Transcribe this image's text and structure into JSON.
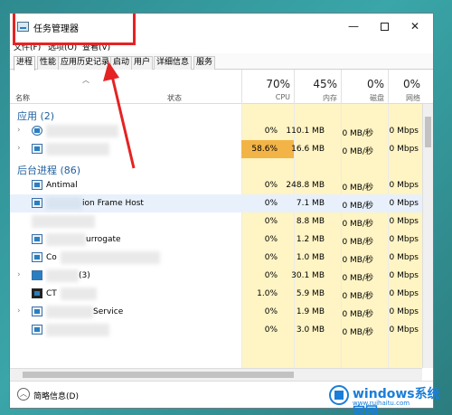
{
  "window": {
    "title": "任务管理器"
  },
  "menu": [
    "文件(F)",
    "选项(O)",
    "查看(V)"
  ],
  "tabs": [
    "进程",
    "性能",
    "应用历史记录",
    "启动",
    "用户",
    "详细信息",
    "服务"
  ],
  "header": {
    "name_label": "名称",
    "status_label": "状态",
    "cpu": {
      "pct": "70%",
      "label": "CPU"
    },
    "mem": {
      "pct": "45%",
      "label": "内存"
    },
    "disk": {
      "pct": "0%",
      "label": "磁盘"
    },
    "net": {
      "pct": "0%",
      "label": "网络"
    }
  },
  "groups": {
    "apps": "应用 (2)",
    "background": "后台进程 (86)"
  },
  "rows": [
    {
      "expand": "›",
      "name": "",
      "cpu": "0%",
      "mem": "110.1 MB",
      "disk": "0 MB/秒",
      "net": "0 Mbps"
    },
    {
      "expand": "›",
      "name": "",
      "cpu": "58.6%",
      "mem": "16.6 MB",
      "disk": "0 MB/秒",
      "net": "0 Mbps"
    },
    {
      "expand": "",
      "name": "Antimal",
      "cpu": "0%",
      "mem": "248.8 MB",
      "disk": "0 MB/秒",
      "net": "0 Mbps"
    },
    {
      "expand": "",
      "name": "ion Frame Host",
      "cpu": "0%",
      "mem": "7.1 MB",
      "disk": "0 MB/秒",
      "net": "0 Mbps"
    },
    {
      "expand": "",
      "name": "",
      "cpu": "0%",
      "mem": "8.8 MB",
      "disk": "0 MB/秒",
      "net": "0 Mbps"
    },
    {
      "expand": "",
      "name": "urrogate",
      "cpu": "0%",
      "mem": "1.2 MB",
      "disk": "0 MB/秒",
      "net": "0 Mbps"
    },
    {
      "expand": "",
      "name": "Co",
      "cpu": "0%",
      "mem": "1.0 MB",
      "disk": "0 MB/秒",
      "net": "0 Mbps"
    },
    {
      "expand": "›",
      "name": "(3)",
      "cpu": "0%",
      "mem": "30.1 MB",
      "disk": "0 MB/秒",
      "net": "0 Mbps"
    },
    {
      "expand": "",
      "name": "CT",
      "cpu": "1.0%",
      "mem": "5.9 MB",
      "disk": "0 MB/秒",
      "net": "0 Mbps"
    },
    {
      "expand": "›",
      "name": "Service",
      "cpu": "0%",
      "mem": "1.9 MB",
      "disk": "0 MB/秒",
      "net": "0 Mbps"
    },
    {
      "expand": "",
      "name": "",
      "cpu": "0%",
      "mem": "3.0 MB",
      "disk": "0 MB/秒",
      "net": "0 Mbps"
    }
  ],
  "footer": {
    "less_label": "简略信息(D)"
  },
  "watermark": {
    "text": "windows系统家园",
    "url": "www.ruihaitu.com"
  },
  "colors": {
    "highlight": "#f3b447",
    "column_bg": "#fff4c4",
    "annotation": "#e52323",
    "group": "#1f5f9f"
  }
}
